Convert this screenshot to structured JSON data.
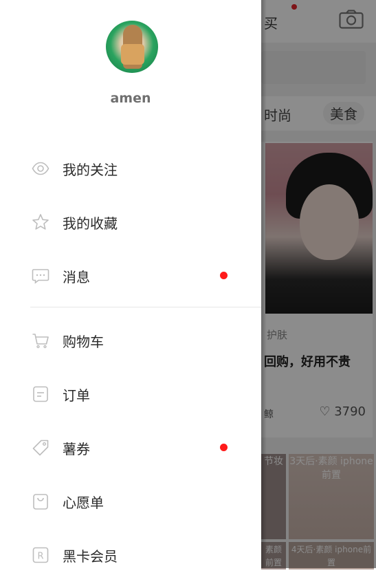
{
  "background": {
    "top_buy_text": "买",
    "tabs": [
      "时尚",
      "美食"
    ],
    "card": {
      "category": "护肤",
      "title": "回购，好用不贵",
      "author": "鲸",
      "likes": "3790"
    },
    "thumbs": [
      "节妆",
      "3天后·素颜 iphone前置",
      "素颜 前置",
      "4天后·素颜 iphone前置"
    ]
  },
  "drawer": {
    "username": "amen",
    "items": [
      {
        "label": "我的关注",
        "icon": "eye-icon",
        "badge": false
      },
      {
        "label": "我的收藏",
        "icon": "star-icon",
        "badge": false
      },
      {
        "label": "消息",
        "icon": "chat-bubble-icon",
        "badge": true
      },
      {
        "label": "购物车",
        "icon": "cart-icon",
        "badge": false
      },
      {
        "label": "订单",
        "icon": "order-icon",
        "badge": false
      },
      {
        "label": "薯券",
        "icon": "coupon-tag-icon",
        "badge": true
      },
      {
        "label": "心愿单",
        "icon": "wishlist-bag-icon",
        "badge": false
      },
      {
        "label": "黑卡会员",
        "icon": "registered-card-icon",
        "badge": false
      }
    ]
  },
  "colors": {
    "badge": "#ff1a1a",
    "icon_stroke": "#bdbdbd"
  }
}
